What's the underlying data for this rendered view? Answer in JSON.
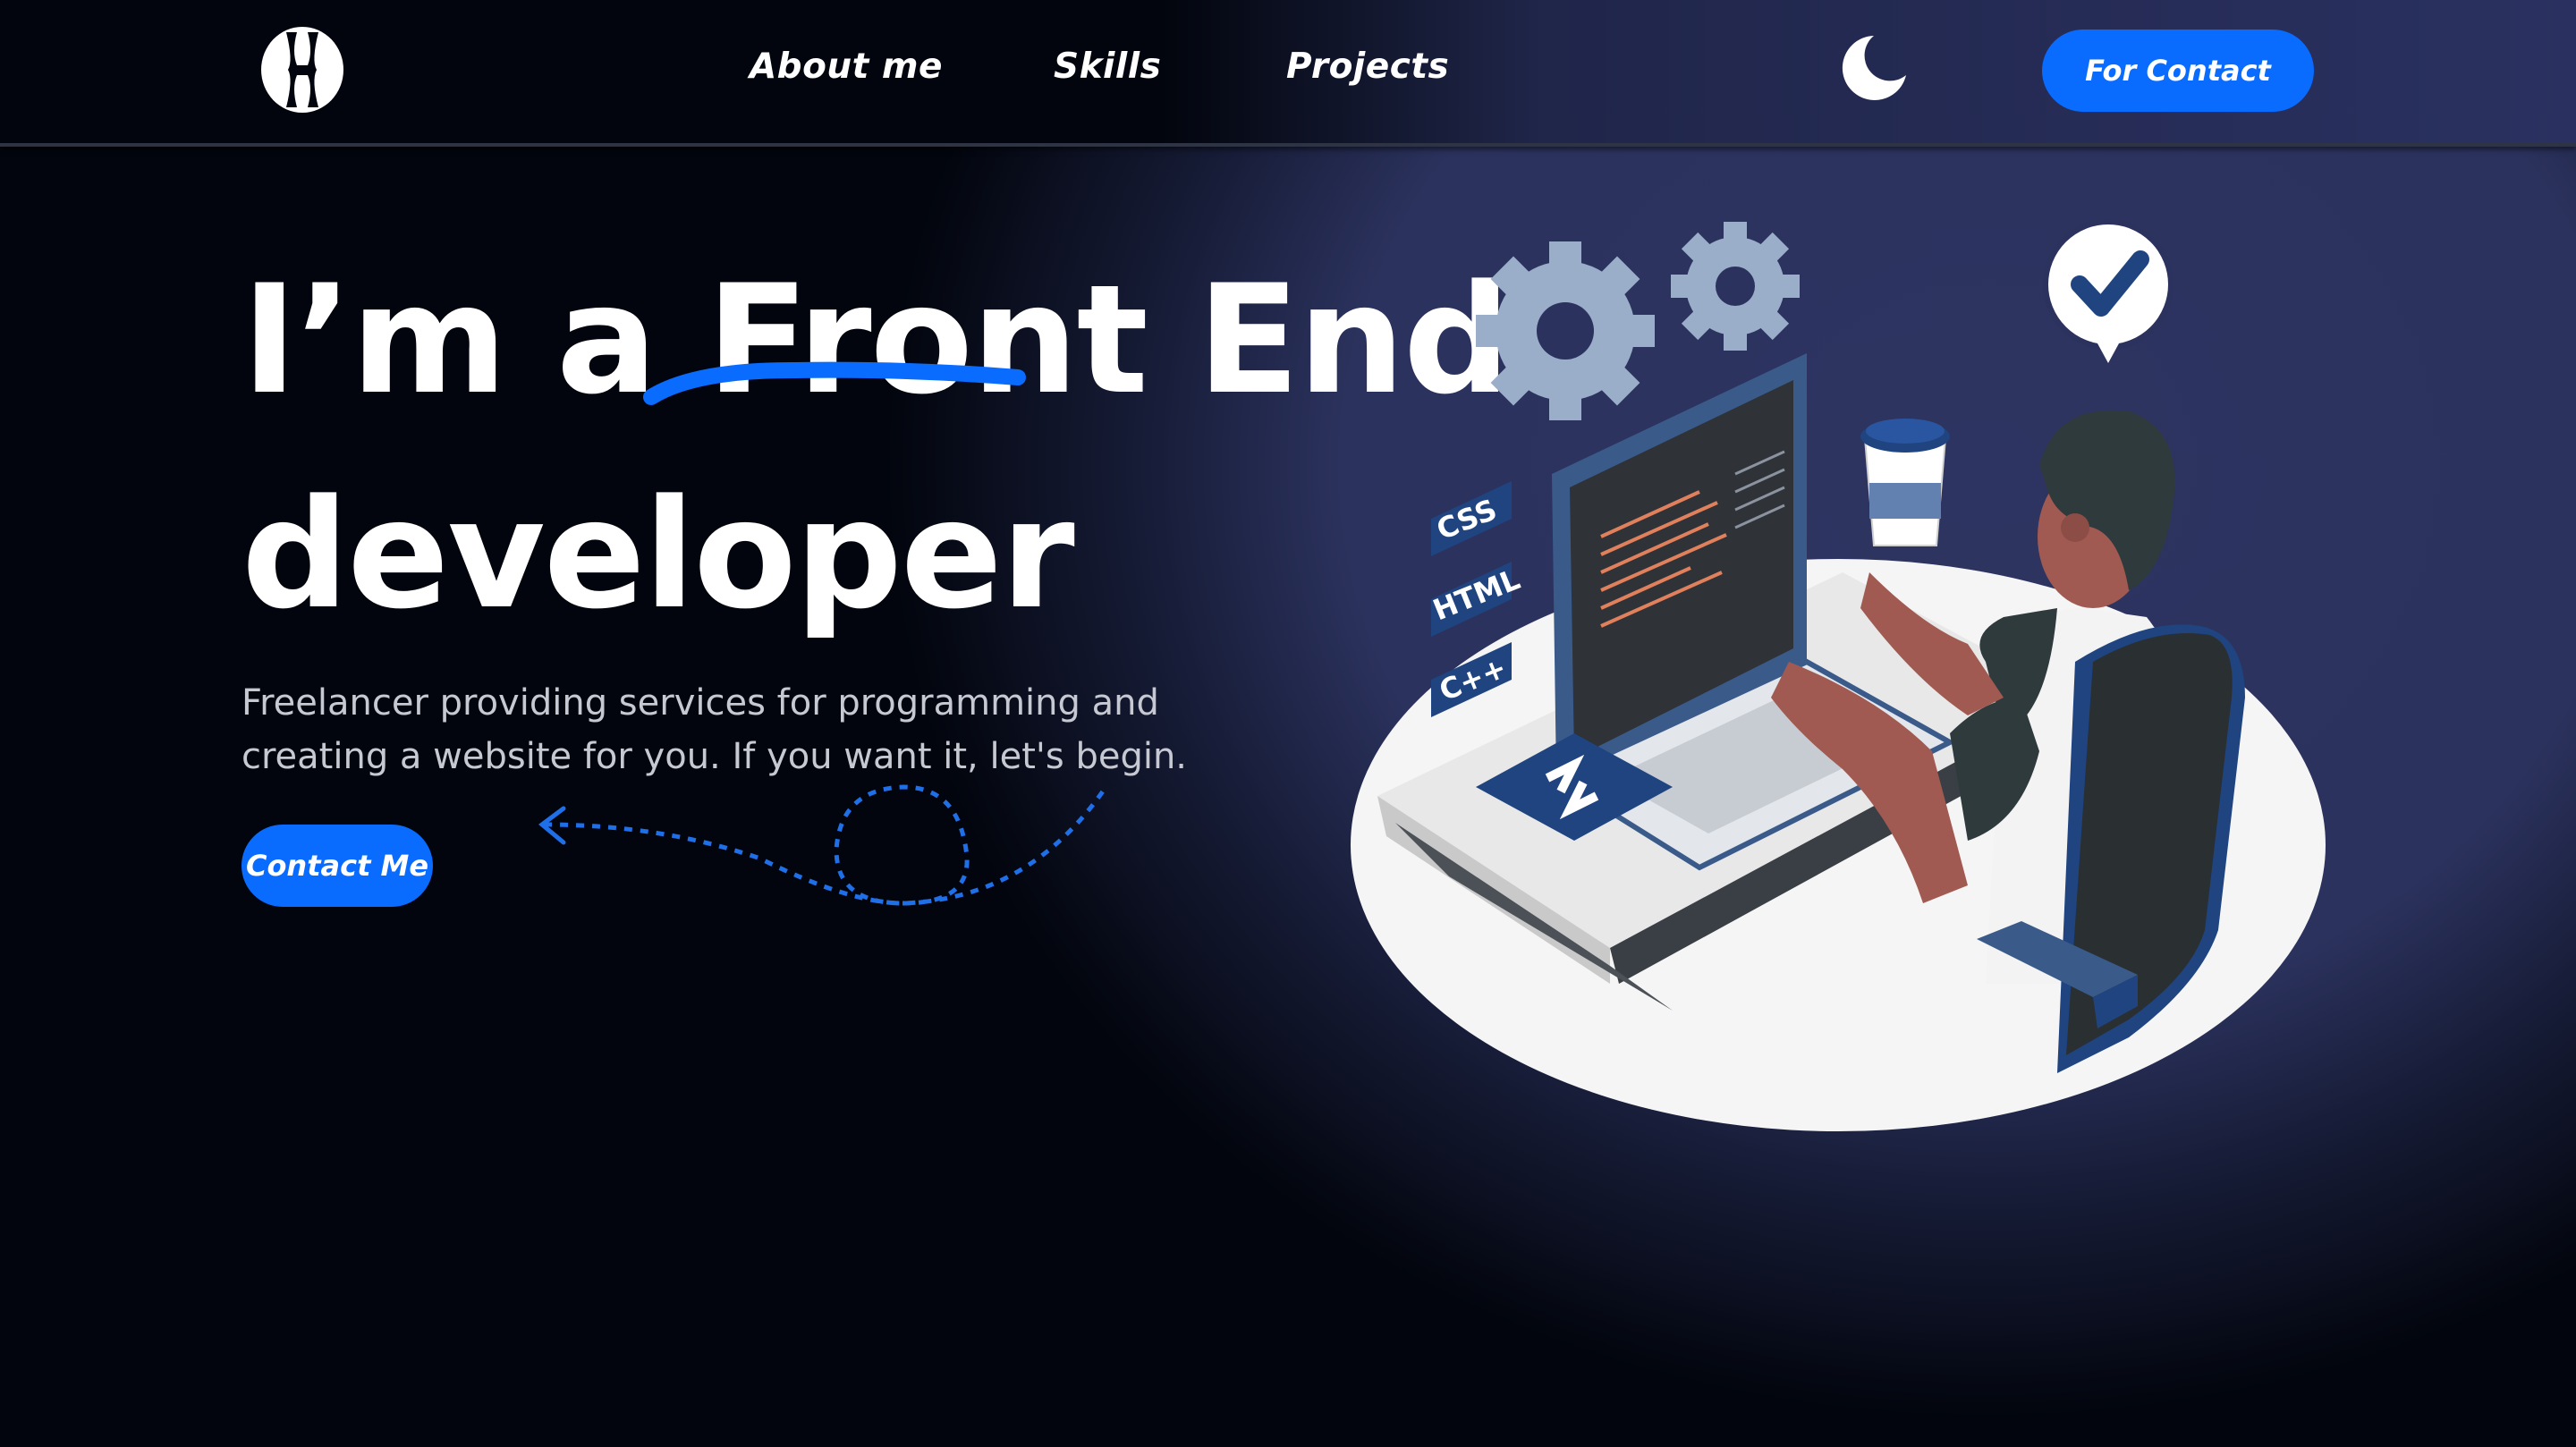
{
  "header": {
    "logo_icon": "h-monogram-logo",
    "nav": [
      {
        "label": "About me"
      },
      {
        "label": "Skills"
      },
      {
        "label": "Projects"
      }
    ],
    "theme_toggle_icon": "moon-icon",
    "contact_button": "For Contact"
  },
  "hero": {
    "title_part1": "I’m a ",
    "title_highlight": "Front",
    "title_part2": " End",
    "title_line2": "developer",
    "description": "Freelancer providing services for programming and creating a website for you. If you want it, let's begin.",
    "cta_button": "Contact Me"
  },
  "illustration": {
    "tags": [
      "CSS",
      "HTML",
      "C++"
    ]
  },
  "colors": {
    "accent": "#0a6cff",
    "background": "#02050d",
    "glow": "#2b325d"
  }
}
